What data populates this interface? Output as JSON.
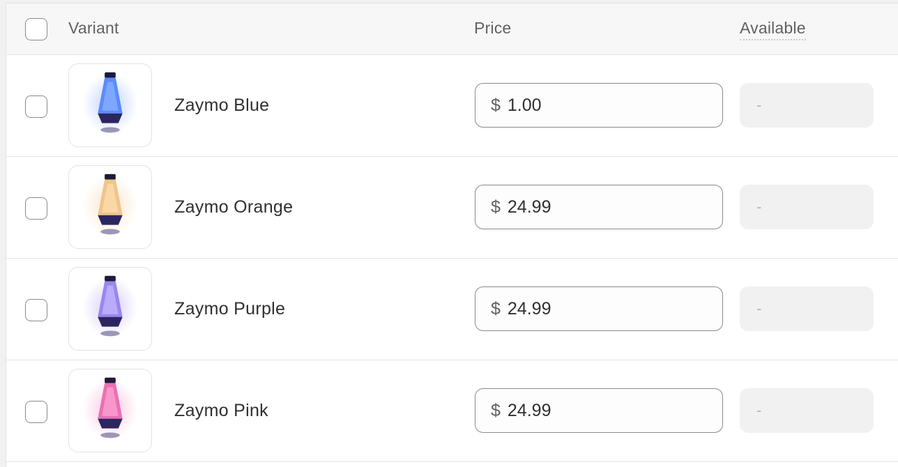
{
  "header": {
    "variant_label": "Variant",
    "price_label": "Price",
    "available_label": "Available"
  },
  "rows": [
    {
      "name": "Zaymo Blue",
      "currency": "$",
      "price": "1.00",
      "available": "-",
      "image_icon": "lava-lamp-blue-icon",
      "color": "#4a7dff"
    },
    {
      "name": "Zaymo Orange",
      "currency": "$",
      "price": "24.99",
      "available": "-",
      "image_icon": "lava-lamp-orange-icon",
      "color": "#f2b36a"
    },
    {
      "name": "Zaymo Purple",
      "currency": "$",
      "price": "24.99",
      "available": "-",
      "image_icon": "lava-lamp-purple-icon",
      "color": "#8a6cf0"
    },
    {
      "name": "Zaymo Pink",
      "currency": "$",
      "price": "24.99",
      "available": "-",
      "image_icon": "lava-lamp-pink-icon",
      "color": "#f05aa8"
    }
  ]
}
